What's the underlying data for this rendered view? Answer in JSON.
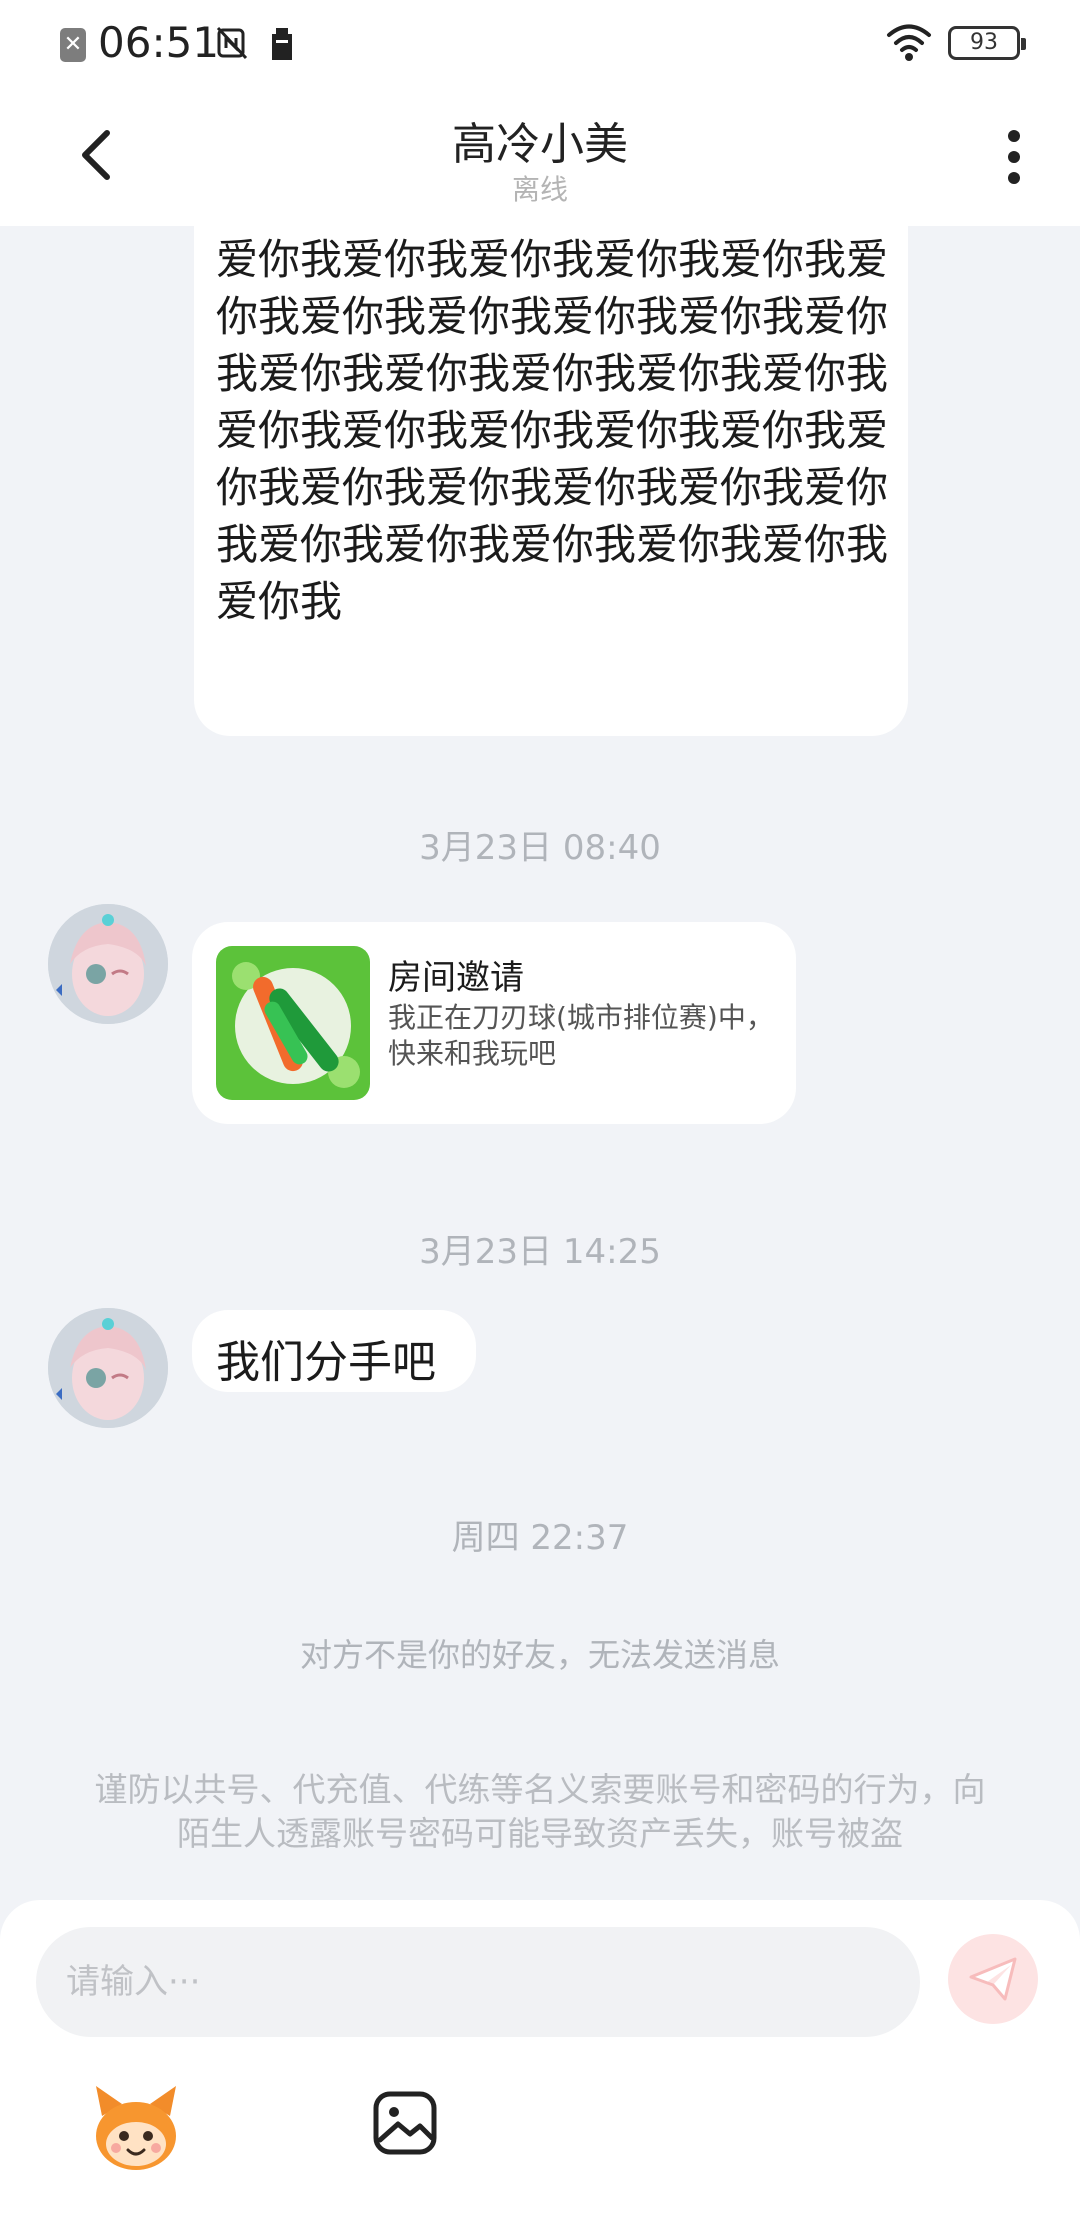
{
  "status_bar": {
    "time": "06:51",
    "battery": "93",
    "icons": [
      "sim-off-icon",
      "nfc-off-icon",
      "storage-icon",
      "wifi-icon",
      "battery-icon"
    ]
  },
  "header": {
    "title": "高冷小美",
    "subtitle": "离线",
    "icons": [
      "back-arrow-icon",
      "more-vertical-icon"
    ]
  },
  "messages": {
    "long_love_text": "我爱你我爱你我爱你我爱你我爱你我爱你我爱你我爱你我爱你我爱你我爱你我爱你我爱你我爱你我爱你我爱你我爱你我爱你我爱你我爱你我爱你我爱你我爱你我爱你我爱你我爱你我爱你我爱你我爱你我爱你我爱你我爱你我爱你我爱你我爱你我爱你我爱你我爱你我",
    "timestamp_1": "3月23日 08:40",
    "invite": {
      "title": "房间邀请",
      "desc": "我正在刀刃球(城市排位赛)中，快来和我玩吧"
    },
    "timestamp_2": "3月23日 14:25",
    "breakup": "我们分手吧",
    "timestamp_3": "周四 22:37",
    "not_friend_notice": "对方不是你的好友，无法发送消息",
    "security_warning": "谨防以共号、代充值、代练等名义索要账号和密码的行为，向陌生人透露账号密码可能导致资产丢失，账号被盗"
  },
  "input": {
    "placeholder": "请输入···",
    "icons": [
      "send-icon",
      "emoji-mascot-icon",
      "image-icon"
    ]
  },
  "colors": {
    "background": "#f1f3f7",
    "bubble": "#ffffff",
    "muted_text": "#b0b4ba",
    "send_button": "#fde3e3",
    "send_icon": "#f7bcbc"
  }
}
